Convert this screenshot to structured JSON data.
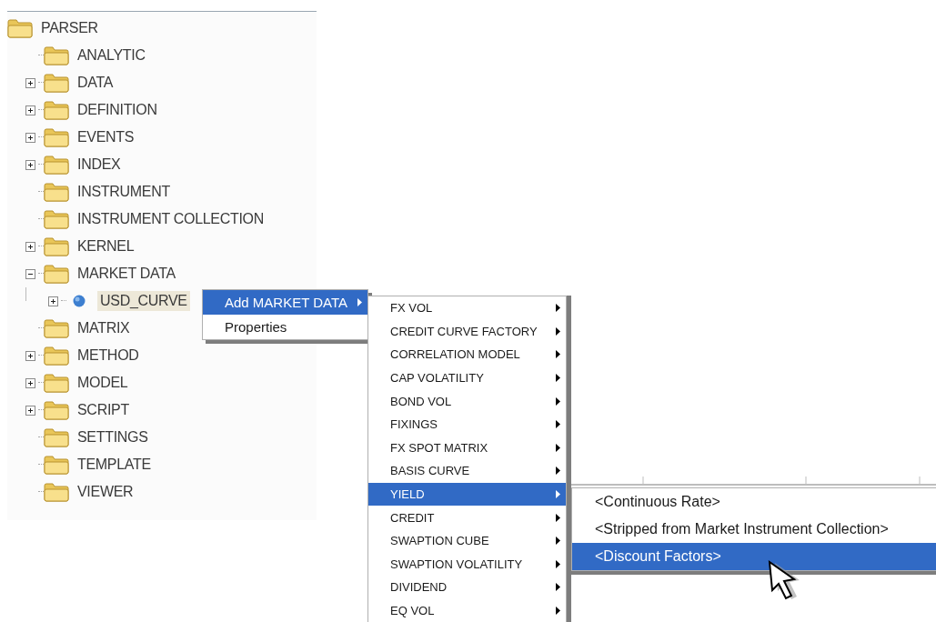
{
  "tree": {
    "root": {
      "label": "PARSER",
      "kind": "folder",
      "selected": false,
      "children": [
        {
          "label": "ANALYTIC",
          "kind": "folder",
          "has_children": false,
          "selected": false
        },
        {
          "label": "DATA",
          "kind": "folder",
          "has_children": true,
          "expanded": false,
          "selected": false
        },
        {
          "label": "DEFINITION",
          "kind": "folder",
          "has_children": true,
          "expanded": false,
          "selected": false
        },
        {
          "label": "EVENTS",
          "kind": "folder",
          "has_children": true,
          "expanded": false,
          "selected": false
        },
        {
          "label": "INDEX",
          "kind": "folder",
          "has_children": true,
          "expanded": false,
          "selected": false
        },
        {
          "label": "INSTRUMENT",
          "kind": "folder",
          "has_children": false,
          "selected": false
        },
        {
          "label": "INSTRUMENT COLLECTION",
          "kind": "folder",
          "has_children": false,
          "selected": false
        },
        {
          "label": "KERNEL",
          "kind": "folder",
          "has_children": true,
          "expanded": false,
          "selected": false
        },
        {
          "label": "MARKET DATA",
          "kind": "folder",
          "has_children": true,
          "expanded": true,
          "selected": false,
          "children": [
            {
              "label": "USD_CURVE",
              "kind": "globe",
              "has_children": true,
              "expanded": false,
              "selected": true
            }
          ]
        },
        {
          "label": "MATRIX",
          "kind": "folder",
          "has_children": false,
          "selected": false
        },
        {
          "label": "METHOD",
          "kind": "folder",
          "has_children": true,
          "expanded": false,
          "selected": false
        },
        {
          "label": "MODEL",
          "kind": "folder",
          "has_children": true,
          "expanded": false,
          "selected": false
        },
        {
          "label": "SCRIPT",
          "kind": "folder",
          "has_children": true,
          "expanded": false,
          "selected": false
        },
        {
          "label": "SETTINGS",
          "kind": "folder",
          "has_children": false,
          "selected": false
        },
        {
          "label": "TEMPLATE",
          "kind": "folder",
          "has_children": false,
          "selected": false
        },
        {
          "label": "VIEWER",
          "kind": "folder",
          "has_children": false,
          "selected": false
        }
      ]
    }
  },
  "context_menu": {
    "items": [
      {
        "label": "Add MARKET DATA",
        "selected": true,
        "has_submenu": true
      },
      {
        "label": "Properties",
        "selected": false,
        "has_submenu": false
      }
    ]
  },
  "submenu": {
    "items": [
      {
        "label": "FX VOL",
        "selected": false,
        "has_submenu": true
      },
      {
        "label": "CREDIT CURVE FACTORY",
        "selected": false,
        "has_submenu": true
      },
      {
        "label": "CORRELATION MODEL",
        "selected": false,
        "has_submenu": true
      },
      {
        "label": "CAP VOLATILITY",
        "selected": false,
        "has_submenu": true
      },
      {
        "label": "BOND VOL",
        "selected": false,
        "has_submenu": true
      },
      {
        "label": "FIXINGS",
        "selected": false,
        "has_submenu": true
      },
      {
        "label": "FX SPOT MATRIX",
        "selected": false,
        "has_submenu": true
      },
      {
        "label": "BASIS CURVE",
        "selected": false,
        "has_submenu": true
      },
      {
        "label": "YIELD",
        "selected": true,
        "has_submenu": true
      },
      {
        "label": "CREDIT",
        "selected": false,
        "has_submenu": true
      },
      {
        "label": "SWAPTION CUBE",
        "selected": false,
        "has_submenu": true
      },
      {
        "label": "SWAPTION VOLATILITY",
        "selected": false,
        "has_submenu": true
      },
      {
        "label": "DIVIDEND",
        "selected": false,
        "has_submenu": true
      },
      {
        "label": "EQ VOL",
        "selected": false,
        "has_submenu": true
      }
    ]
  },
  "yield_submenu": {
    "items": [
      {
        "label": "<Continuous Rate>",
        "selected": false
      },
      {
        "label": "<Stripped from Market Instrument Collection>",
        "selected": false
      },
      {
        "label": "<Discount Factors>",
        "selected": true
      }
    ]
  }
}
